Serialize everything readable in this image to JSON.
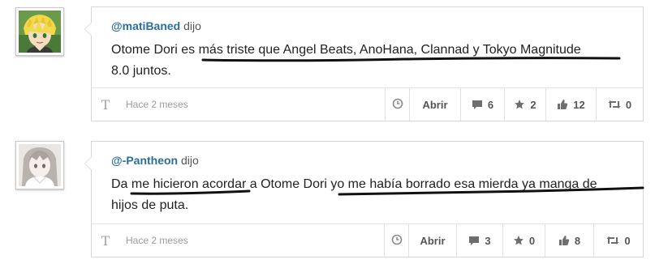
{
  "posts": [
    {
      "username": "@matiBaned",
      "said": "dijo",
      "text_line1": "Otome Dori es más triste que Angel Beats, AnoHana, Clannad y Tokyo Magnitude",
      "text_line2": "8.0 juntos.",
      "date": "Hace 2 meses",
      "open_label": "Abrir",
      "comments": "6",
      "favorites": "2",
      "likes": "12",
      "reposts": "0"
    },
    {
      "username": "@-Pantheon",
      "said": "dijo",
      "text_line1": "Da me hicieron acordar a Otome Dori yo me había borrado esa mierda ya manga de",
      "text_line2": "hijos de puta.",
      "date": "Hace 2 meses",
      "open_label": "Abrir",
      "comments": "3",
      "favorites": "0",
      "likes": "8",
      "reposts": "0"
    }
  ],
  "icons": {
    "type": "type-icon",
    "clock": "clock-icon",
    "comment": "comment-icon",
    "star": "star-icon",
    "like": "thumbs-up-icon",
    "repost": "repost-icon"
  },
  "colors": {
    "username": "#2a6f9b",
    "scribble": "#111111"
  }
}
